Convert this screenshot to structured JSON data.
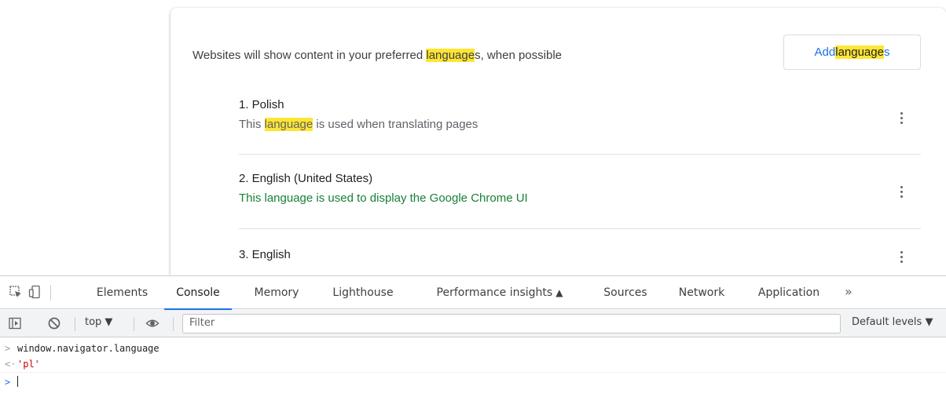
{
  "settings": {
    "header": {
      "text_before": "Websites will show content in your preferred ",
      "highlight": "language",
      "text_after": "s, when possible"
    },
    "add_button": {
      "prefix": "Add ",
      "highlight": "language",
      "suffix": "s"
    },
    "languages": [
      {
        "name": "1. Polish",
        "desc_before": "This ",
        "desc_highlight": "language",
        "desc_after": " is used when translating pages"
      },
      {
        "name": "2. English (United States)",
        "desc": "This language is used to display the Google Chrome UI"
      },
      {
        "name": "3. English"
      }
    ],
    "colors": {
      "highlight": "#ffe533",
      "accent": "#1a73e8",
      "ui_language_note": "#188038"
    }
  },
  "devtools": {
    "toolbar_icons": [
      "inspect-element-icon",
      "device-toolbar-icon"
    ],
    "tabs": [
      {
        "label": "Elements"
      },
      {
        "label": "Console",
        "active": true
      },
      {
        "label": "Memory"
      },
      {
        "label": "Lighthouse"
      },
      {
        "label": "Performance insights",
        "icon": "flask-icon"
      },
      {
        "label": "Sources"
      },
      {
        "label": "Network"
      },
      {
        "label": "Application"
      }
    ],
    "more_tabs": "»",
    "filterbar": {
      "context": "top ▼",
      "filter_placeholder": "Filter",
      "levels": "Default levels ▼"
    },
    "console": {
      "input": "window.navigator.language",
      "output": "'pl'"
    }
  }
}
